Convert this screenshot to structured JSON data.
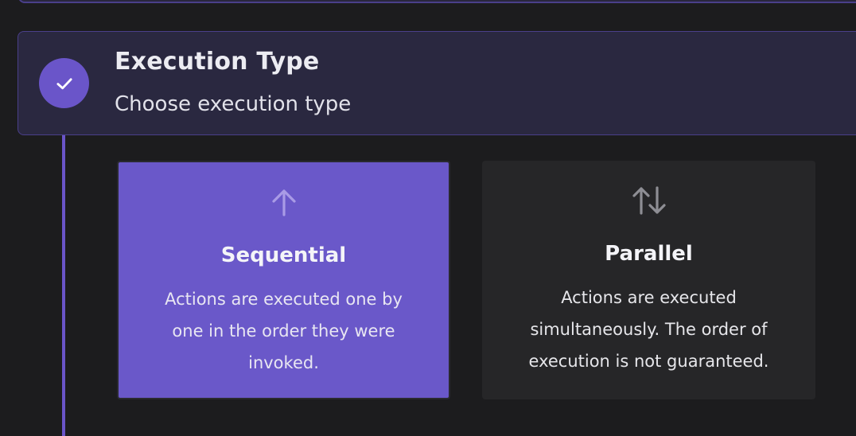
{
  "step": {
    "title": "Execution Type",
    "subtitle": "Choose execution type",
    "status_icon": "check-icon"
  },
  "options": [
    {
      "title": "Sequential",
      "description": "Actions are executed one by one in the order they were invoked.",
      "icon": "arrow-up-icon",
      "selected": true
    },
    {
      "title": "Parallel",
      "description": "Actions are executed simultaneously. The order of execution is not guaranteed.",
      "icon": "arrows-up-down-icon",
      "selected": false
    }
  ],
  "colors": {
    "accent": "#6a55c9",
    "background": "#1c1c1e",
    "card": "#2a2840",
    "option_unselected": "#262628"
  }
}
